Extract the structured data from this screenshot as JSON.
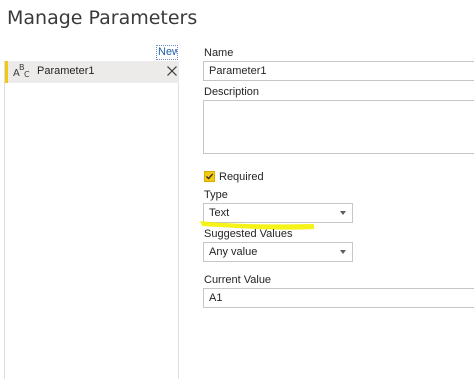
{
  "dialog": {
    "title": "Manage Parameters",
    "new_link": "New"
  },
  "parameters_list": [
    {
      "label": "Parameter1",
      "type_icon": "abc-text-icon",
      "selected": true
    }
  ],
  "form": {
    "name_label": "Name",
    "name_value": "Parameter1",
    "description_label": "Description",
    "description_value": "",
    "required_label": "Required",
    "required_checked": true,
    "type_label": "Type",
    "type_value": "Text",
    "suggested_label": "Suggested Values",
    "suggested_value": "Any value",
    "current_label": "Current Value",
    "current_value": "A1"
  },
  "colors": {
    "accent": "#f2c811",
    "link": "#1f5fa8",
    "highlighter": "#f5f200"
  }
}
